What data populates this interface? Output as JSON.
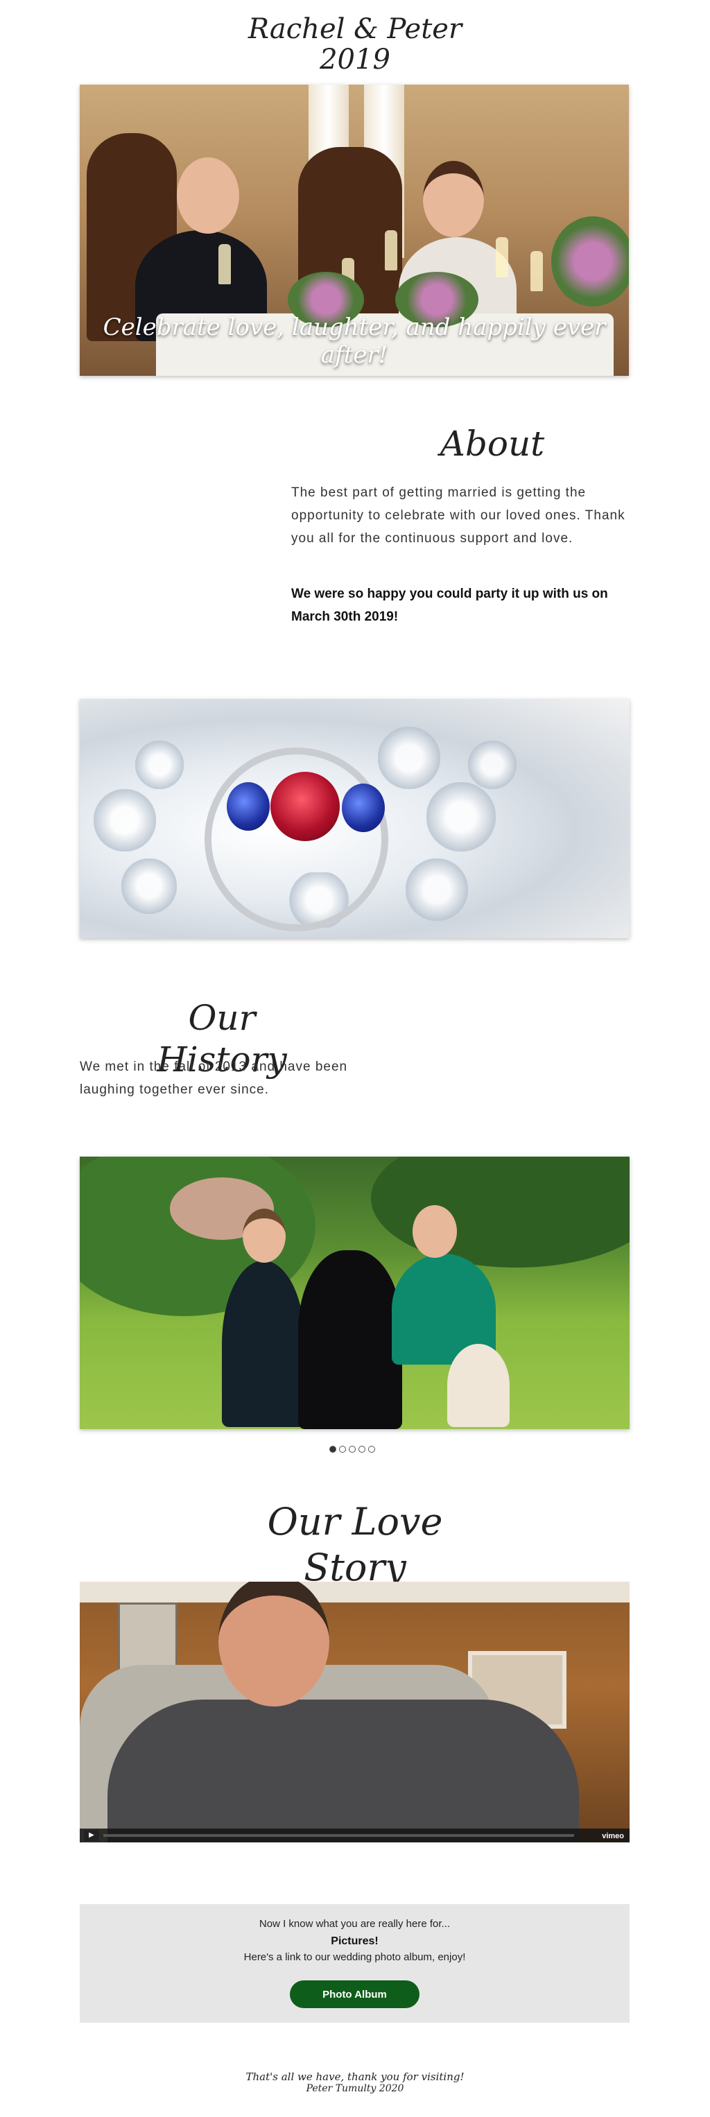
{
  "header": {
    "title_line1": "Rachel & Peter",
    "title_line2": "2019"
  },
  "hero": {
    "caption": "Celebrate love, laughter, and happily ever after!"
  },
  "about": {
    "heading": "About",
    "body": "The best part of getting married is getting the opportunity to celebrate with our loved ones. Thank you all for the continuous support and love.",
    "bold": "We were so happy you could party it up with us on March 30th 2019!"
  },
  "history": {
    "heading": "Our History",
    "body": "We met in the fall of 2013 and have been laughing together ever since."
  },
  "slideshow": {
    "slide_count": 5,
    "active_index": 0
  },
  "love_story": {
    "heading": "Our Love Story",
    "video_player": "vimeo"
  },
  "pictures": {
    "line1": "Now I know what you are really here for...",
    "line2": "Pictures!",
    "line3": "Here's a link to our wedding photo album, enjoy!",
    "button_label": "Photo Album",
    "button_color": "#0f5d1a"
  },
  "footer": {
    "thanks": "That's all we have, thank you for visiting!",
    "credit": "Peter Tumulty 2020"
  }
}
